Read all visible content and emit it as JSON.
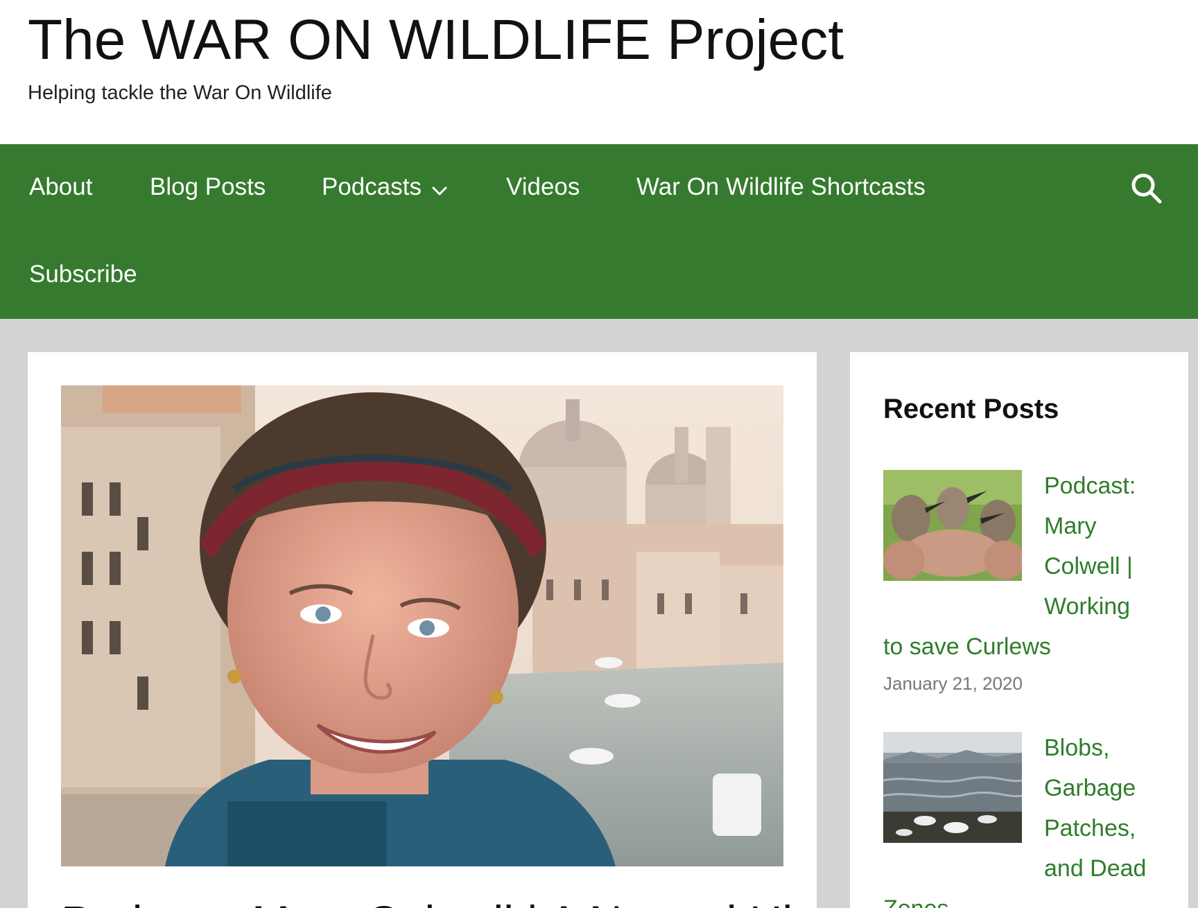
{
  "site": {
    "title": "The WAR ON WILDLIFE Project",
    "tagline": "Helping tackle the War On Wildlife"
  },
  "colors": {
    "nav_background": "#357a2e",
    "page_background": "#d3d3d3",
    "link_green": "#2f7d2a",
    "date_gray": "#777777"
  },
  "nav": {
    "items": [
      {
        "label": "About"
      },
      {
        "label": "Blog Posts"
      },
      {
        "label": "Podcasts",
        "icon": "chevron-down-icon"
      },
      {
        "label": "Videos"
      },
      {
        "label": "War On Wildlife Shortcasts"
      },
      {
        "label": "Subscribe"
      }
    ],
    "search_icon": "search-icon"
  },
  "main": {
    "featured_image": "portrait-of-smiling-woman-with-headband-in-venice",
    "post_title_partial": "Podcast: Mary Colwell | A Natural Hist"
  },
  "sidebar": {
    "widget_title": "Recent Posts",
    "posts": [
      {
        "thumb": "hands-holding-curlew-chicks",
        "title_lines": [
          "Podcast:",
          "Mary",
          "Colwell |",
          "Working",
          "to save Curlews"
        ],
        "date": "January 21, 2020"
      },
      {
        "thumb": "dead-seabirds-on-shoreline",
        "title_lines": [
          "Blobs,",
          "Garbage",
          "Patches,",
          "and Dead",
          "Zones"
        ]
      }
    ]
  }
}
